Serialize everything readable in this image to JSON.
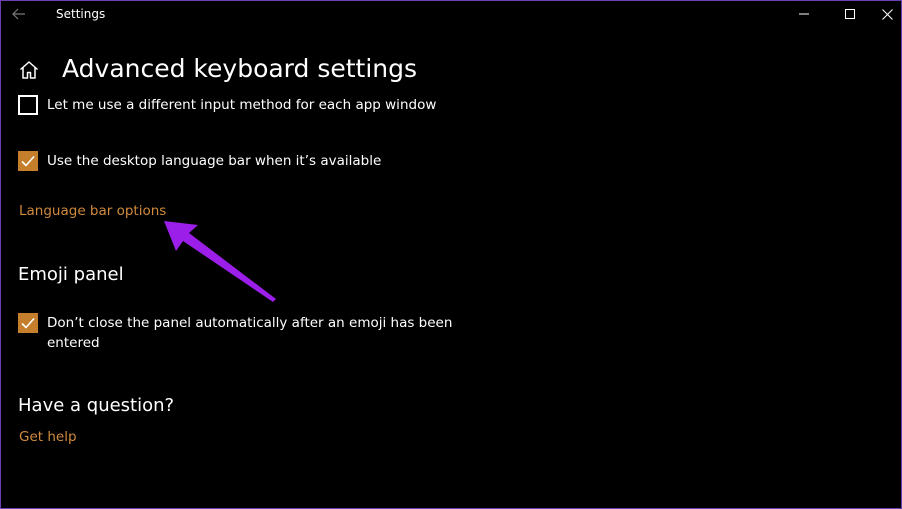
{
  "window": {
    "title": "Settings"
  },
  "page": {
    "title": "Advanced keyboard settings"
  },
  "options": {
    "input_method_per_app": {
      "label": "Let me use a different input method for each app window",
      "checked": false
    },
    "desktop_language_bar": {
      "label": "Use the desktop language bar when it’s available",
      "checked": true
    }
  },
  "language_bar_link": "Language bar options",
  "emoji": {
    "heading": "Emoji panel",
    "keep_open": {
      "label": "Don’t close the panel automatically after an emoji has been entered",
      "checked": true
    }
  },
  "help": {
    "heading": "Have a question?",
    "link": "Get help"
  },
  "colors": {
    "accent": "#c47e2c",
    "link": "#d08a3c",
    "annotation_arrow": "#9b1fe8",
    "window_border": "#6a3fb0"
  },
  "icons": {
    "back": "back-arrow-icon",
    "minimize": "minimize-icon",
    "maximize": "maximize-icon",
    "close": "close-icon",
    "home": "home-icon",
    "check": "checkmark-icon"
  }
}
